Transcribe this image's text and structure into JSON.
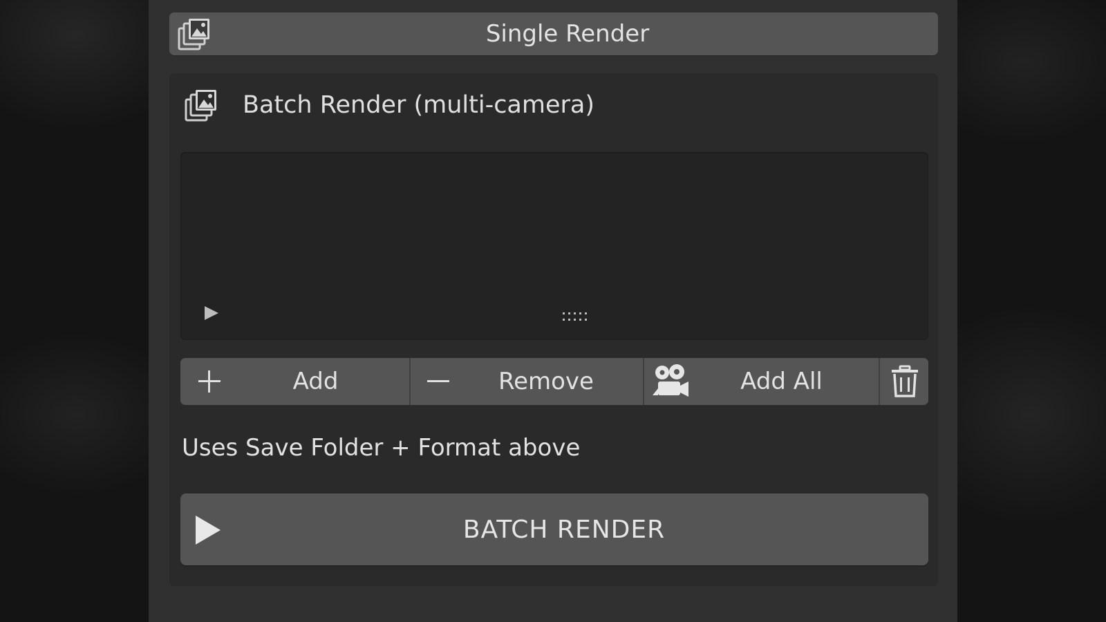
{
  "single_render": {
    "label": "Single Render",
    "icon": "image-stack-icon"
  },
  "batch_render": {
    "title": "Batch Render (multi-camera)",
    "icon": "image-stack-icon",
    "camera_list": {
      "items": [],
      "expand_icon": "triangle-right-icon",
      "grip_icon": "resize-grip-icon"
    },
    "buttons": {
      "add": {
        "label": "Add",
        "icon": "plus-icon"
      },
      "remove": {
        "label": "Remove",
        "icon": "minus-icon"
      },
      "add_all": {
        "label": "Add All",
        "icon": "camera-icon"
      },
      "clear": {
        "icon": "trash-icon"
      }
    },
    "info": "Uses Save Folder + Format above",
    "run": {
      "label": "BATCH RENDER",
      "icon": "play-icon"
    }
  },
  "colors": {
    "panel_bg": "#303030",
    "box_bg": "#2a2a2a",
    "list_bg": "#232323",
    "button_bg": "#555555",
    "text": "#e2e2e2"
  }
}
